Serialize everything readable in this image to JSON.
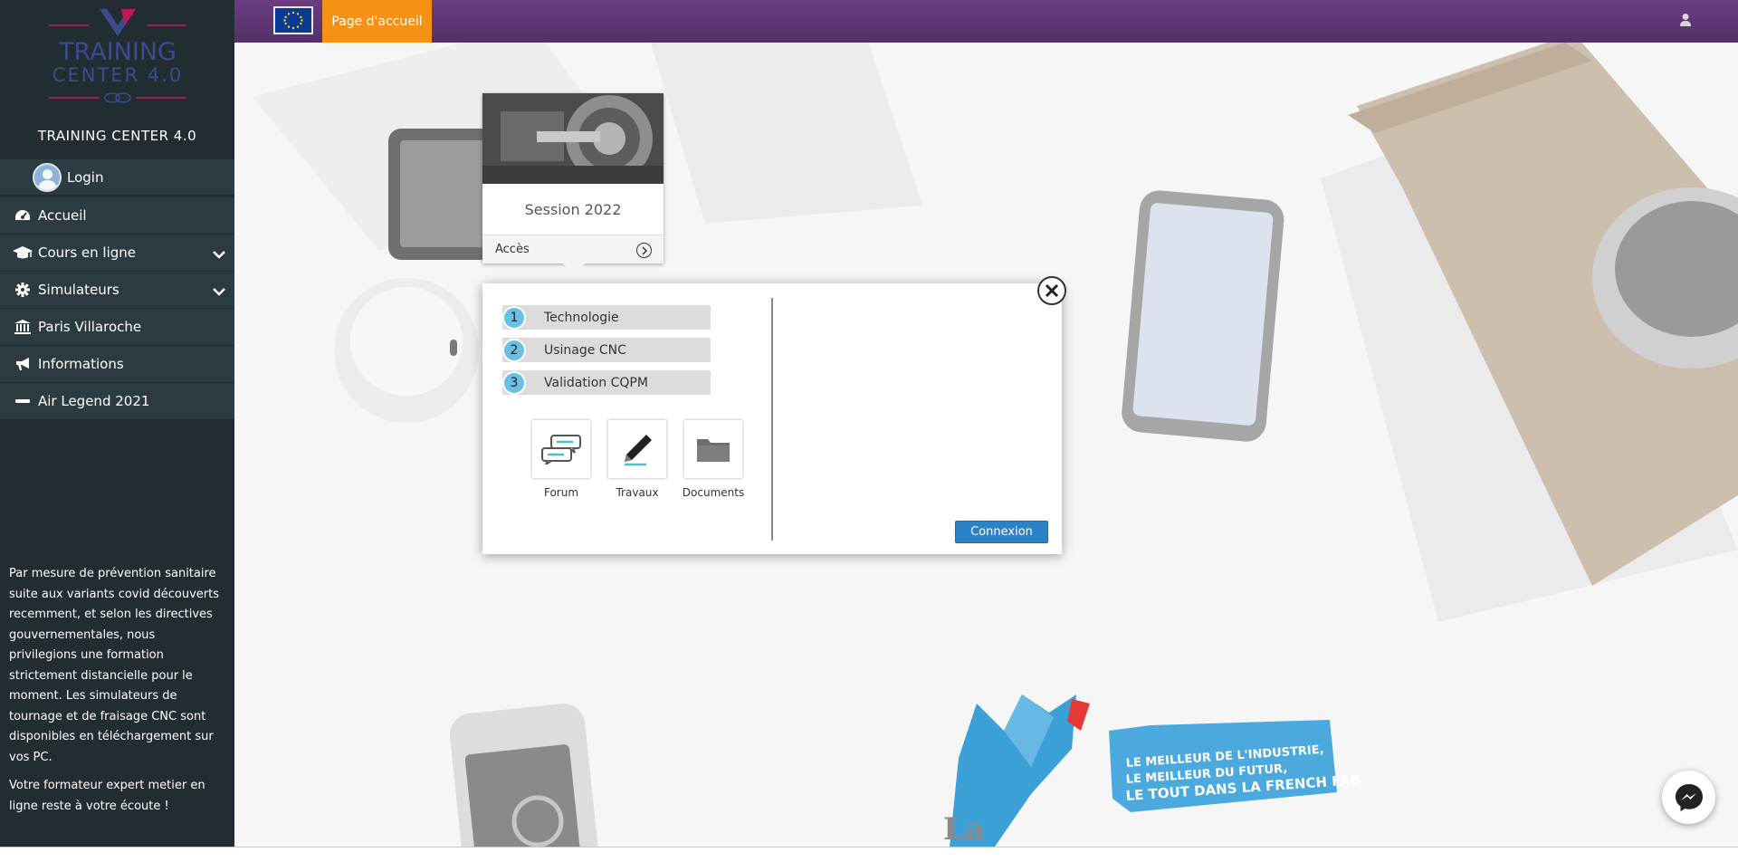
{
  "sidebar": {
    "logo_text_line1": "TRAINING",
    "logo_text_line2": "CENTER 4.0",
    "brand": "TRAINING CENTER 4.0",
    "login_label": "Login",
    "menu": [
      {
        "label": "Accueil",
        "icon": "dashboard-icon"
      },
      {
        "label": "Cours en ligne",
        "icon": "graduation-cap-icon"
      },
      {
        "label": "Simulateurs",
        "icon": "gear-icon"
      },
      {
        "label": "Paris Villaroche",
        "icon": "institution-icon"
      },
      {
        "label": "Informations",
        "icon": "bullhorn-icon"
      },
      {
        "label": "Air Legend 2021",
        "icon": "minus-icon"
      }
    ],
    "notice_p1": "Par mesure de prévention sanitaire suite aux variants covid découverts recemment, et selon les directives gouvernementales, nous privilegions une formation strictement distancielle pour le moment. Les simulateurs de tournage et de fraisage CNC sont disponibles en téléchargement sur vos PC.",
    "notice_p2": "Votre formateur expert metier en ligne reste à votre écoute !"
  },
  "topbar": {
    "home_tab": "Page d'accueil",
    "flag_icon": "eu-flag-icon",
    "user_icon": "user-icon",
    "accent_color": "#f79114",
    "bar_color": "#5e3574"
  },
  "card": {
    "title": "Session 2022",
    "access_label": "Accès"
  },
  "popup": {
    "steps": [
      {
        "num": "1",
        "label": "Technologie"
      },
      {
        "num": "2",
        "label": "Usinage CNC"
      },
      {
        "num": "3",
        "label": "Validation CQPM"
      }
    ],
    "tools": [
      {
        "label": "Forum",
        "icon": "chat-bubbles-icon"
      },
      {
        "label": "Travaux",
        "icon": "pen-icon"
      },
      {
        "label": "Documents",
        "icon": "folder-icon"
      }
    ],
    "connexion_label": "Connexion",
    "button_color": "#2c82c6"
  },
  "background": {
    "banner_lines": [
      "LE MEILLEUR DE L'INDUSTRIE,",
      "LE MEILLEUR DU FUTUR,",
      "LE TOUT DANS LA FRENCH FAB"
    ],
    "la_text": "La"
  }
}
